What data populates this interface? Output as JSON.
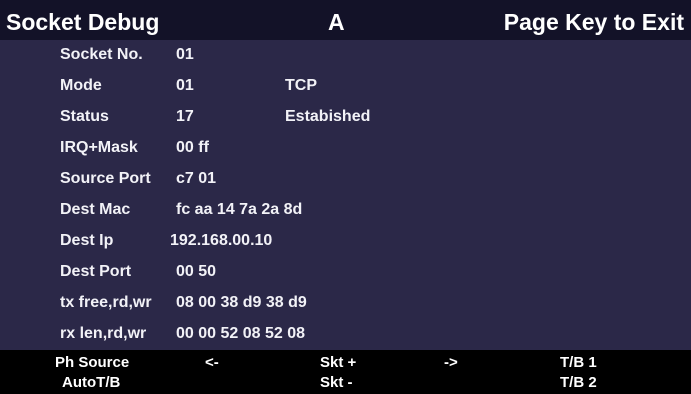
{
  "header": {
    "title": "Socket Debug",
    "channel": "A",
    "exit_hint": "Page Key to Exit"
  },
  "fields": {
    "socket_no": {
      "label": "Socket No.",
      "value": "01"
    },
    "mode": {
      "label": "Mode",
      "value": "01",
      "extra": "TCP"
    },
    "status": {
      "label": "Status",
      "value": "17",
      "extra": "Estabished"
    },
    "irq_mask": {
      "label": "IRQ+Mask",
      "value": "00 ff"
    },
    "source_port": {
      "label": "Source Port",
      "value": "c7 01"
    },
    "dest_mac": {
      "label": "Dest Mac",
      "value": "fc aa 14 7a 2a 8d"
    },
    "dest_ip": {
      "label": "Dest Ip",
      "value": "192.168.00.10"
    },
    "dest_port": {
      "label": "Dest Port",
      "value": "00 50"
    },
    "tx": {
      "label": "tx free,rd,wr",
      "value": "08 00 38 d9 38 d9"
    },
    "rx": {
      "label": "rx len,rd,wr",
      "value": "00 00 52 08 52 08"
    }
  },
  "softkeys": {
    "ph_source": "Ph Source",
    "auto_tb": "AutoT/B",
    "prev": "<-",
    "skt_plus": "Skt +",
    "skt_minus": "Skt -",
    "next": "->",
    "tb1": "T/B 1",
    "tb2": "T/B 2"
  },
  "colors": {
    "background": "#2b2848",
    "title_bar": "#131228",
    "softkey_bar": "#000000",
    "text": "#ffffff"
  }
}
